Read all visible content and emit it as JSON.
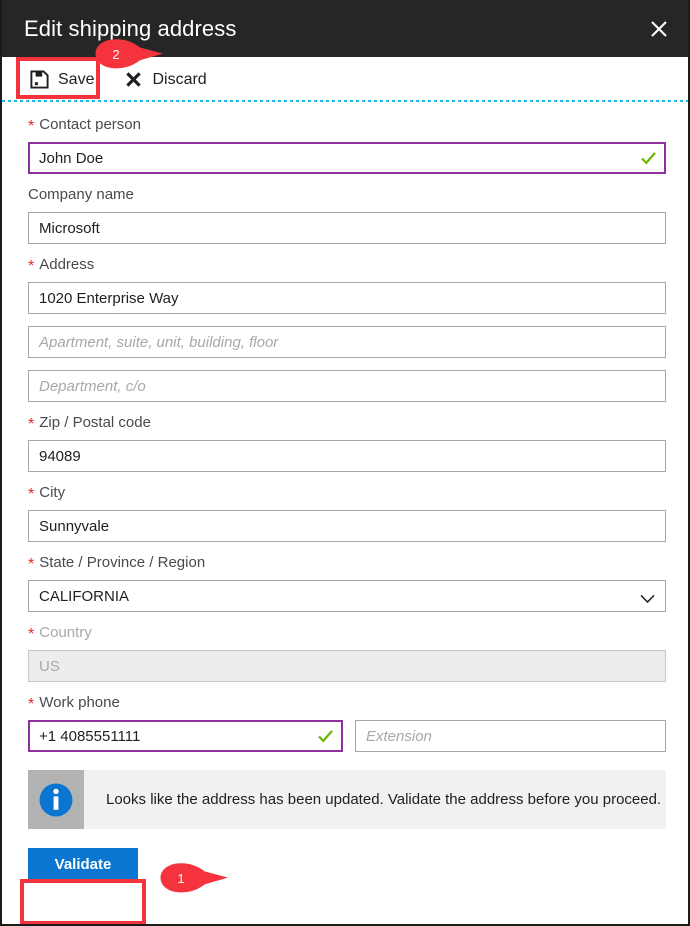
{
  "window": {
    "title": "Edit shipping address",
    "close_icon": "close-icon"
  },
  "commandbar": {
    "save": {
      "label": "Save",
      "icon": "save-floppy-icon"
    },
    "discard": {
      "label": "Discard",
      "icon": "close-x-icon"
    }
  },
  "form": {
    "fields": [
      {
        "label": "Contact person",
        "required": true,
        "value": "John Doe",
        "state": "valid",
        "trailing_icon": "green-check-icon"
      },
      {
        "label": "Company name",
        "required": false,
        "value": "Microsoft",
        "state": "normal"
      },
      {
        "label": "Address",
        "required": true,
        "value": "1020 Enterprise Way",
        "state": "normal"
      },
      {
        "label": "",
        "required": false,
        "placeholder": "Apartment, suite, unit, building, floor",
        "value": "",
        "state": "placeholder"
      },
      {
        "label": "",
        "required": false,
        "placeholder": "Department, c/o",
        "value": "",
        "state": "placeholder"
      },
      {
        "label": "Zip / Postal code",
        "required": true,
        "value": "94089",
        "state": "normal"
      },
      {
        "label": "City",
        "required": true,
        "value": "Sunnyvale",
        "state": "normal"
      },
      {
        "label": "State / Province / Region",
        "required": true,
        "value": "CALIFORNIA",
        "state": "dropdown",
        "trailing_icon": "chevron-down-icon"
      },
      {
        "label": "Country",
        "required": true,
        "value": "US",
        "state": "disabled"
      },
      {
        "label": "Work phone",
        "required": true,
        "value": "+1 4085551111",
        "state": "valid",
        "trailing_icon": "green-check-icon",
        "secondary": {
          "placeholder": "Extension",
          "value": ""
        }
      }
    ]
  },
  "infobar": {
    "icon": "info-circle-icon",
    "message": "Looks like the address has been updated. Validate the address before you proceed."
  },
  "validate": {
    "label": "Validate"
  },
  "callouts": [
    {
      "number": "1",
      "target": "validate-button"
    },
    {
      "number": "2",
      "target": "save-button"
    }
  ],
  "colors": {
    "titlebar_bg": "#262626",
    "accent_blue": "#0b76d0",
    "valid_border_purple": "#8e30a0",
    "check_green": "#6bb700",
    "required_red": "#e32b2b",
    "callout_red": "#f4333d",
    "highlight_red": "#f4333d",
    "dashed_line_blue": "#18b4f0",
    "infobar_bg": "#f1f1f1",
    "infobar_icon_bg": "#b3b3b3",
    "disabled_bg": "#ededed"
  }
}
